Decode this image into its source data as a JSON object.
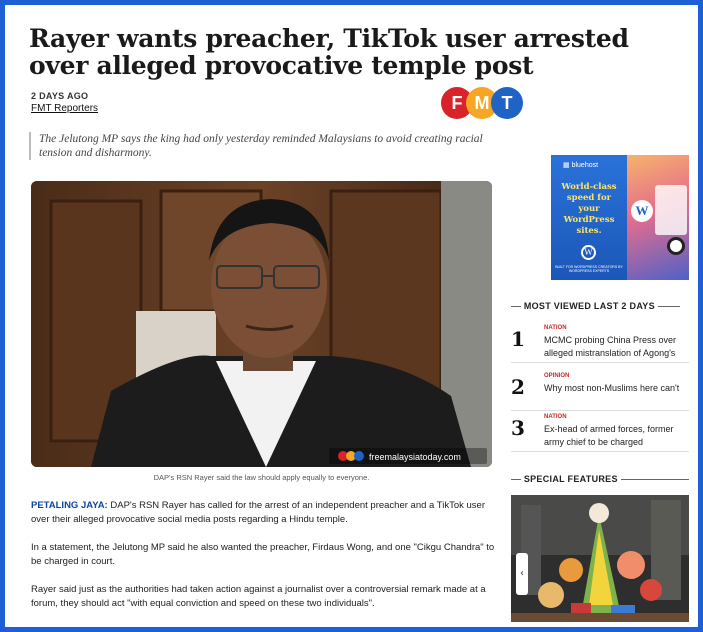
{
  "article": {
    "headline": "Rayer wants preacher, TikTok user arrested over alleged provocative temple post",
    "date": "2 DAYS AGO",
    "author": "FMT Reporters",
    "standfirst": "The Jelutong MP says the king had only yesterday reminded Malaysians to avoid creating racial tension and disharmony.",
    "photo_watermark": "freemalaysiatoday.com",
    "photo_caption": "DAP's RSN Rayer said the law should apply equally to everyone.",
    "dateline": "PETALING JAYA:",
    "p1": "DAP's RSN Rayer has called for the arrest of an independent preacher and a TikTok user over their alleged provocative social media posts regarding a Hindu temple.",
    "p2": "In a statement, the Jelutong MP said he also wanted the preacher, Firdaus Wong, and one \"Cikgu Chandra\" to be charged in court.",
    "p3": "Rayer said just as the authorities had taken action against a journalist over a controversial remark made at a forum, they should act \"with equal conviction and speed on these two individuals\"."
  },
  "logo": {
    "letters": [
      "F",
      "M",
      "T"
    ],
    "colors": [
      "#d8232a",
      "#f5a623",
      "#1e63c5"
    ]
  },
  "ad": {
    "brand": "bluehost",
    "tagline": "World-class speed for your WordPress sites.",
    "footer": "BUILT FOR WORDPRESS CREATORS BY WORDPRESS EXPERTS"
  },
  "most_viewed": {
    "heading": "MOST VIEWED LAST 2 DAYS",
    "items": [
      {
        "num": "1",
        "tag": "NATION",
        "title": "MCMC probing China Press over alleged mistranslation of Agong's speech"
      },
      {
        "num": "2",
        "tag": "OPINION",
        "title": "Why most non-Muslims here can't"
      },
      {
        "num": "3",
        "tag": "NATION",
        "title": "Ex-head of armed forces, former army chief to be charged"
      }
    ]
  },
  "special_features": {
    "heading": "SPECIAL FEATURES",
    "prev_icon": "chevron-left-icon"
  }
}
